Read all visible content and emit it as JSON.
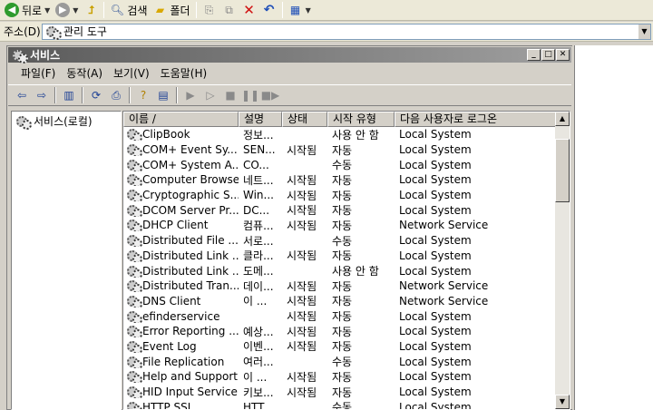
{
  "toolbar": {
    "back_label": "뒤로",
    "search_label": "검색",
    "folders_label": "폴더"
  },
  "address": {
    "label": "주소(D)",
    "value": "관리 도구"
  },
  "window": {
    "title": "서비스"
  },
  "menu": [
    "파일(F)",
    "동작(A)",
    "보기(V)",
    "도움말(H)"
  ],
  "tree": {
    "root_label": "서비스(로컬)"
  },
  "table": {
    "columns": [
      "이름  /",
      "설명",
      "상태",
      "시작 유형",
      "다음 사용자로 로그온"
    ],
    "rows": [
      {
        "name": "ClipBook",
        "desc": "정보...",
        "status": "",
        "startup": "사용 안 함",
        "logon": "Local System"
      },
      {
        "name": "COM+ Event Sy...",
        "desc": "SEN...",
        "status": "시작됨",
        "startup": "자동",
        "logon": "Local System"
      },
      {
        "name": "COM+ System A...",
        "desc": "CO...",
        "status": "",
        "startup": "수동",
        "logon": "Local System"
      },
      {
        "name": "Computer Browser",
        "desc": "네트...",
        "status": "시작됨",
        "startup": "자동",
        "logon": "Local System"
      },
      {
        "name": "Cryptographic S...",
        "desc": "Win...",
        "status": "시작됨",
        "startup": "자동",
        "logon": "Local System"
      },
      {
        "name": "DCOM Server Pr...",
        "desc": "DC...",
        "status": "시작됨",
        "startup": "자동",
        "logon": "Local System"
      },
      {
        "name": "DHCP Client",
        "desc": "컴퓨...",
        "status": "시작됨",
        "startup": "자동",
        "logon": "Network Service"
      },
      {
        "name": "Distributed File ...",
        "desc": "서로...",
        "status": "",
        "startup": "수동",
        "logon": "Local System"
      },
      {
        "name": "Distributed Link ...",
        "desc": "클라...",
        "status": "시작됨",
        "startup": "자동",
        "logon": "Local System"
      },
      {
        "name": "Distributed Link ...",
        "desc": "도메...",
        "status": "",
        "startup": "사용 안 함",
        "logon": "Local System"
      },
      {
        "name": "Distributed Tran...",
        "desc": "데이...",
        "status": "시작됨",
        "startup": "자동",
        "logon": "Network Service"
      },
      {
        "name": "DNS Client",
        "desc": "이 ...",
        "status": "시작됨",
        "startup": "자동",
        "logon": "Network Service"
      },
      {
        "name": "efinderservice",
        "desc": "",
        "status": "시작됨",
        "startup": "자동",
        "logon": "Local System"
      },
      {
        "name": "Error Reporting ...",
        "desc": "예상...",
        "status": "시작됨",
        "startup": "자동",
        "logon": "Local System"
      },
      {
        "name": "Event Log",
        "desc": "이벤...",
        "status": "시작됨",
        "startup": "자동",
        "logon": "Local System"
      },
      {
        "name": "File Replication",
        "desc": "여러...",
        "status": "",
        "startup": "수동",
        "logon": "Local System"
      },
      {
        "name": "Help and Support",
        "desc": "이 ...",
        "status": "시작됨",
        "startup": "자동",
        "logon": "Local System"
      },
      {
        "name": "HID Input Service",
        "desc": "키보...",
        "status": "시작됨",
        "startup": "자동",
        "logon": "Local System"
      },
      {
        "name": "HTTP SSL",
        "desc": "HTT...",
        "status": "",
        "startup": "수동",
        "logon": "Local System"
      }
    ]
  }
}
